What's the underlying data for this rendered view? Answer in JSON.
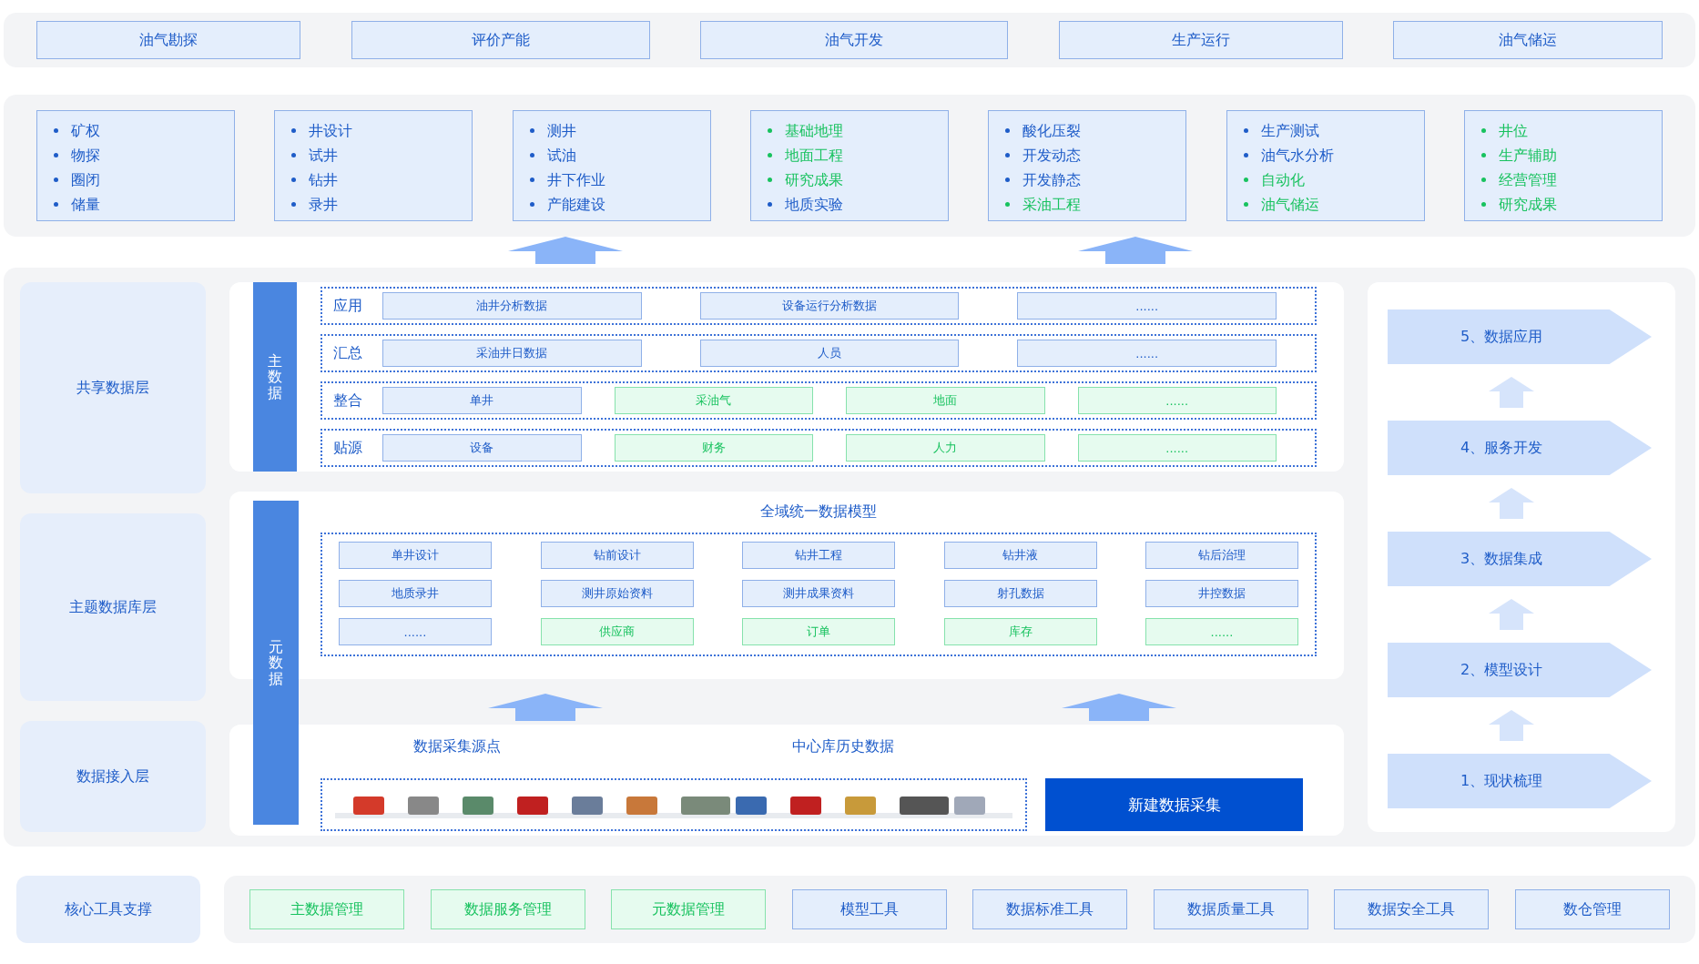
{
  "stages": [
    {
      "label": "油气勘探"
    },
    {
      "label": "评价产能"
    },
    {
      "label": "油气开发"
    },
    {
      "label": "生产运行"
    },
    {
      "label": "油气储运"
    }
  ],
  "categories": [
    {
      "items": [
        {
          "text": "矿权",
          "kind": "primary"
        },
        {
          "text": "物探",
          "kind": "primary"
        },
        {
          "text": "圈闭",
          "kind": "primary"
        },
        {
          "text": "储量",
          "kind": "primary"
        }
      ]
    },
    {
      "items": [
        {
          "text": "井设计",
          "kind": "primary"
        },
        {
          "text": "试井",
          "kind": "primary"
        },
        {
          "text": "钻井",
          "kind": "primary"
        },
        {
          "text": "录井",
          "kind": "primary"
        }
      ]
    },
    {
      "items": [
        {
          "text": "测井",
          "kind": "primary"
        },
        {
          "text": "试油",
          "kind": "primary"
        },
        {
          "text": "井下作业",
          "kind": "primary"
        },
        {
          "text": "产能建设",
          "kind": "primary"
        }
      ]
    },
    {
      "items": [
        {
          "text": "基础地理",
          "kind": "secondary"
        },
        {
          "text": "地面工程",
          "kind": "secondary"
        },
        {
          "text": "研究成果",
          "kind": "secondary"
        },
        {
          "text": "地质实验",
          "kind": "primary"
        }
      ]
    },
    {
      "items": [
        {
          "text": "酸化压裂",
          "kind": "primary"
        },
        {
          "text": "开发动态",
          "kind": "primary"
        },
        {
          "text": "开发静态",
          "kind": "primary"
        },
        {
          "text": "采油工程",
          "kind": "secondary"
        }
      ]
    },
    {
      "items": [
        {
          "text": "生产测试",
          "kind": "primary"
        },
        {
          "text": "油气水分析",
          "kind": "primary"
        },
        {
          "text": "自动化",
          "kind": "secondary"
        },
        {
          "text": "油气储运",
          "kind": "secondary"
        }
      ]
    },
    {
      "items": [
        {
          "text": "井位",
          "kind": "secondary"
        },
        {
          "text": "生产辅助",
          "kind": "secondary"
        },
        {
          "text": "经营管理",
          "kind": "secondary"
        },
        {
          "text": "研究成果",
          "kind": "secondary"
        }
      ]
    }
  ],
  "layers": [
    {
      "label": "共享数据层"
    },
    {
      "label": "主题数据库层"
    },
    {
      "label": "数据接入层"
    }
  ],
  "master_data": {
    "title": "主数据",
    "rows": [
      {
        "label": "应用",
        "cells": [
          {
            "text": "油井分析数据",
            "kind": "primary"
          },
          {
            "text": "设备运行分析数据",
            "kind": "primary"
          },
          {
            "text": "......",
            "kind": "primary"
          }
        ]
      },
      {
        "label": "汇总",
        "cells": [
          {
            "text": "采油井日数据",
            "kind": "primary"
          },
          {
            "text": "人员",
            "kind": "primary"
          },
          {
            "text": "......",
            "kind": "primary"
          }
        ]
      },
      {
        "label": "整合",
        "cells": [
          {
            "text": "单井",
            "kind": "primary"
          },
          {
            "text": "采油气",
            "kind": "secondary"
          },
          {
            "text": "地面",
            "kind": "secondary"
          },
          {
            "text": "......",
            "kind": "secondary"
          }
        ]
      },
      {
        "label": "贴源",
        "cells": [
          {
            "text": "设备",
            "kind": "primary"
          },
          {
            "text": "财务",
            "kind": "secondary"
          },
          {
            "text": "人力",
            "kind": "secondary"
          },
          {
            "text": "......",
            "kind": "secondary"
          }
        ]
      }
    ]
  },
  "metadata": {
    "title": "元数据",
    "model_title": "全域统一数据模型",
    "cells": [
      {
        "text": "单井设计",
        "kind": "primary"
      },
      {
        "text": "钻前设计",
        "kind": "primary"
      },
      {
        "text": "钻井工程",
        "kind": "primary"
      },
      {
        "text": "钻井液",
        "kind": "primary"
      },
      {
        "text": "钻后治理",
        "kind": "primary"
      },
      {
        "text": "地质录井",
        "kind": "primary"
      },
      {
        "text": "测井原始资料",
        "kind": "primary"
      },
      {
        "text": "测井成果资料",
        "kind": "primary"
      },
      {
        "text": "射孔数据",
        "kind": "primary"
      },
      {
        "text": "井控数据",
        "kind": "primary"
      },
      {
        "text": "......",
        "kind": "primary"
      },
      {
        "text": "供应商",
        "kind": "secondary"
      },
      {
        "text": "订单",
        "kind": "secondary"
      },
      {
        "text": "库存",
        "kind": "secondary"
      },
      {
        "text": "......",
        "kind": "secondary"
      }
    ]
  },
  "access": {
    "source_labels": [
      "数据采集源点",
      "中心库历史数据"
    ],
    "button": "新建数据采集"
  },
  "steps": [
    {
      "label": "5、数据应用"
    },
    {
      "label": "4、服务开发"
    },
    {
      "label": "3、数据集成"
    },
    {
      "label": "2、模型设计"
    },
    {
      "label": "1、现状梳理"
    }
  ],
  "tools": {
    "label": "核心工具支撑",
    "items": [
      {
        "text": "主数据管理",
        "kind": "secondary"
      },
      {
        "text": "数据服务管理",
        "kind": "secondary"
      },
      {
        "text": "元数据管理",
        "kind": "secondary"
      },
      {
        "text": "模型工具",
        "kind": "primary"
      },
      {
        "text": "数据标准工具",
        "kind": "primary"
      },
      {
        "text": "数据质量工具",
        "kind": "primary"
      },
      {
        "text": "数据安全工具",
        "kind": "primary"
      },
      {
        "text": "数仓管理",
        "kind": "primary"
      }
    ]
  }
}
